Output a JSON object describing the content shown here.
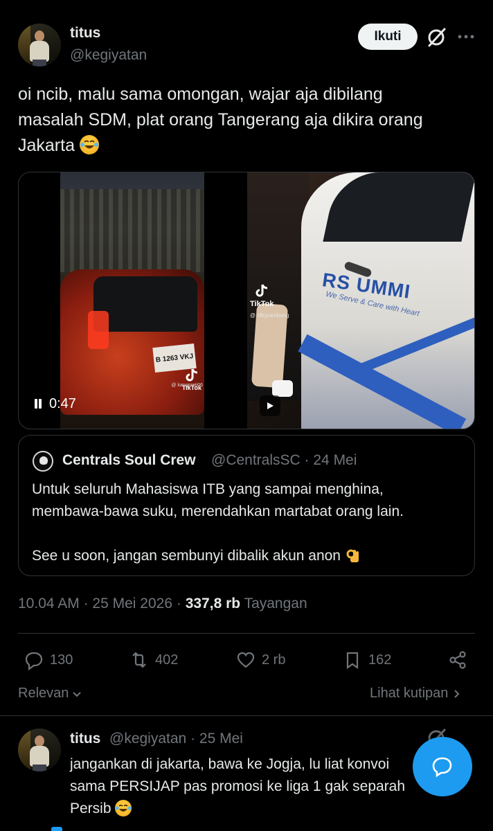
{
  "post": {
    "author_name": "titus",
    "author_handle": "@kegiyatan",
    "follow_label": "Ikuti",
    "text_line1": "oi ncib, malu sama omongan, wajar aja dibilang",
    "text_line2": "masalah SDM, plat orang Tangerang aja dikira orang",
    "text_line3": "Jakarta",
    "emoji": "laughing-tears-emoji"
  },
  "media": {
    "video1": {
      "plate_text": "B 1263 VKJ",
      "tiktok_label": "TikTok",
      "tiktok_user": "@ kanggreti06"
    },
    "video2": {
      "brand_text": "RS UMMI",
      "tagline": "We Serve & Care with Heart",
      "tiktok_label": "TikTok",
      "tiktok_user": "@ rifkyrambang"
    },
    "timer": "0:47"
  },
  "quote": {
    "name": "Centrals Soul Crew",
    "handle": "@CentralsSC",
    "dot": "·",
    "date": "24 Mei",
    "line1": "Untuk seluruh Mahasiswa ITB yang sampai menghina,",
    "line2": "membawa-bawa suku, merendahkan martabat orang lain.",
    "line3": "See u soon, jangan sembunyi dibalik akun anon"
  },
  "meta": {
    "time": "10.04 AM",
    "sep1": "·",
    "date": "25 Mei 2026",
    "sep2": "·",
    "views": "337,8 rb",
    "views_label": "Tayangan"
  },
  "actions": {
    "replies": "130",
    "reposts": "402",
    "likes": "2 rb",
    "bookmarks": "162"
  },
  "filter": {
    "relevan": "Relevan",
    "lihat_kutipan": "Lihat kutipan"
  },
  "reply": {
    "name": "titus",
    "handle": "@kegiyatan",
    "dot": "·",
    "date": "25 Mei",
    "line1": "jangankan di jakarta, bawa ke Jogja, lu liat konvoi",
    "line2": "sama PERSIJAP pas promosi ke liga 1 gak separah",
    "line3": "Persib"
  },
  "colors": {
    "accent": "#1d9bf0",
    "background": "#000000",
    "text": "#e7e9ea",
    "muted": "#71767b",
    "border": "#2f3336"
  }
}
